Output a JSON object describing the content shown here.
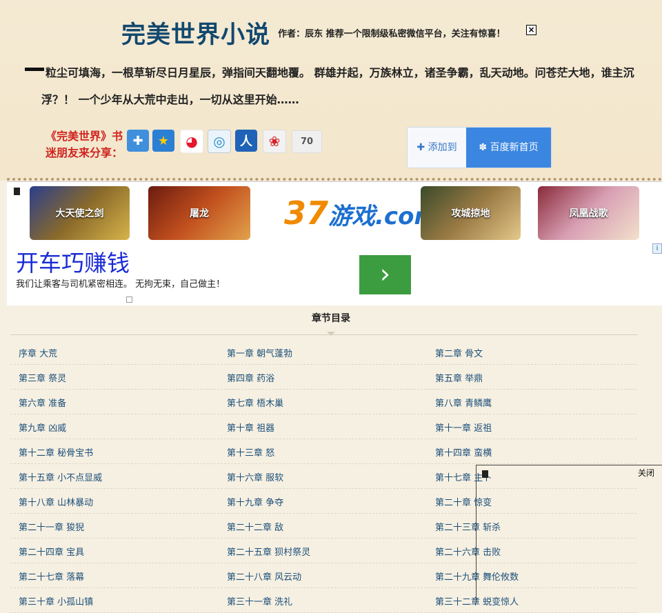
{
  "header": {
    "site_title": "完美世界小说",
    "author_line": "作者：辰东  推荐一个限制级私密微信平台，关注有惊喜！",
    "close_symbol": "×",
    "description": "粒尘可填海，一根草斩尽日月星辰，弹指间天翻地覆。 群雄并起，万族林立，诸圣争霸，乱天动地。问苍茫大地，谁主沉浮？！ 一个少年从大荒中走出，一切从这里开始……"
  },
  "share": {
    "label": "《完美世界》书迷朋友来分享：",
    "count": "70",
    "icons": [
      "more-share-icon",
      "qzone-icon",
      "weibo-icon",
      "tencent-weibo-icon",
      "renren-icon",
      "netease-icon"
    ]
  },
  "baidu": {
    "add_label": "✚ 添加到",
    "home_label": "百度新首页"
  },
  "game_banner": {
    "games": [
      "大天使之剑",
      "屠龙",
      "攻城掠地",
      "凤凰战歌"
    ],
    "brand_main": "37",
    "brand_sub": "游戏.com"
  },
  "text_ad": {
    "headline": "开车巧赚钱",
    "description": "我们让乘客与司机紧密相连。 无拘无束，自己做主！",
    "go_symbol": "›",
    "info_symbol": "i"
  },
  "toc": {
    "title": "章节目录",
    "chapters": [
      [
        "序章 大荒",
        "第一章 朝气蓬勃",
        "第二章 骨文"
      ],
      [
        "第三章 祭灵",
        "第四章 药浴",
        "第五章 举鼎"
      ],
      [
        "第六章 准备",
        "第七章 梧木巢",
        "第八章 青鳞鹰"
      ],
      [
        "第九章 凶威",
        "第十章 祖器",
        "第十一章 返祖"
      ],
      [
        "第十二章 秘骨宝书",
        "第十三章 怒",
        "第十四章 蛮横"
      ],
      [
        "第十五章 小不点显威",
        "第十六章 服软",
        "第十七章 主卜"
      ],
      [
        "第十八章 山林暴动",
        "第十九章 争夺",
        "第二十章 惊变"
      ],
      [
        "第二十一章 狻猊",
        "第二十二章 敌",
        "第二十三章 斩杀"
      ],
      [
        "第二十四章 宝具",
        "第二十五章 狈村祭灵",
        "第二十六章 击败"
      ],
      [
        "第二十七章 落幕",
        "第二十八章 风云动",
        "第二十九章 舞伦攸数"
      ],
      [
        "第三十章 小孤山镇",
        "第三十一章 洗礼",
        "第三十二章 蜕变惊人"
      ]
    ]
  },
  "float_ad": {
    "close_label": "关闭"
  },
  "colors": {
    "title": "#12486e",
    "share_label": "#d0241e",
    "chapter_link": "#1c4f7a",
    "ad_headline": "#1a2bd6",
    "ad_button": "#3b9d3f",
    "baidu_blue": "#3b86e0"
  }
}
